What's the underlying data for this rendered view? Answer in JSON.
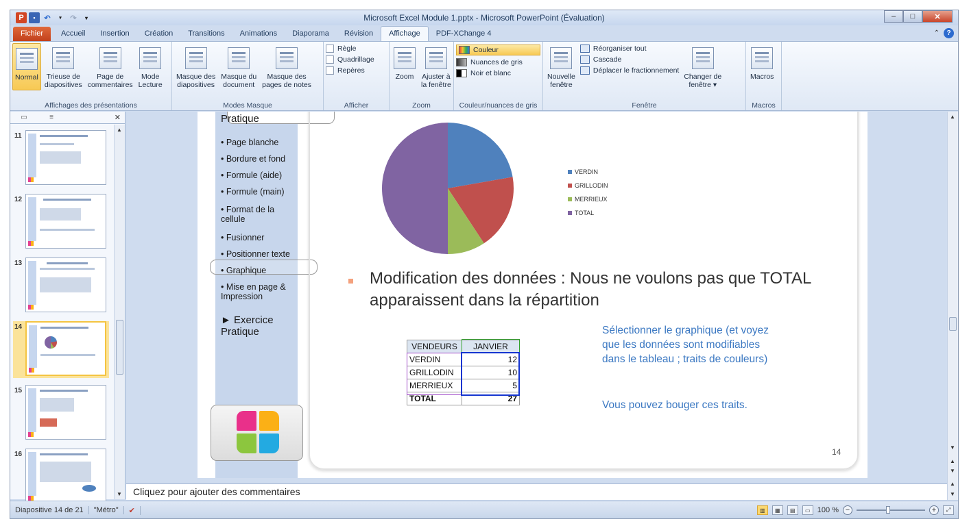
{
  "window": {
    "title": "Microsoft Excel Module 1.pptx - Microsoft PowerPoint (Évaluation)",
    "app_icon": "P"
  },
  "tabs": [
    {
      "label": "Fichier"
    },
    {
      "label": "Accueil"
    },
    {
      "label": "Insertion"
    },
    {
      "label": "Création"
    },
    {
      "label": "Transitions"
    },
    {
      "label": "Animations"
    },
    {
      "label": "Diaporama"
    },
    {
      "label": "Révision"
    },
    {
      "label": "Affichage"
    },
    {
      "label": "PDF-XChange 4"
    }
  ],
  "ribbon": {
    "views": {
      "label": "Affichages des présentations",
      "buttons": [
        "Normal",
        "Trieuse de\ndiapositives",
        "Page de\ncommentaires",
        "Mode\nLecture"
      ]
    },
    "masters": {
      "label": "Modes Masque",
      "buttons": [
        "Masque des\ndiapositives",
        "Masque du\ndocument",
        "Masque des\npages de notes"
      ]
    },
    "show": {
      "label": "Afficher",
      "items": [
        "Règle",
        "Quadrillage",
        "Repères"
      ]
    },
    "zoom": {
      "label": "Zoom",
      "buttons": [
        "Zoom",
        "Ajuster à\nla fenêtre"
      ]
    },
    "color": {
      "label": "Couleur/nuances de gris",
      "items": [
        "Couleur",
        "Nuances de gris",
        "Noir et blanc"
      ]
    },
    "window": {
      "label": "Fenêtre",
      "new_window": "Nouvelle\nfenêtre",
      "items": [
        "Réorganiser tout",
        "Cascade",
        "Déplacer le fractionnement"
      ],
      "switch": "Changer de\nfenêtre ▾"
    },
    "macros": {
      "label": "Macros",
      "button": "Macros"
    }
  },
  "thumbnails": [
    {
      "num": "11"
    },
    {
      "num": "12"
    },
    {
      "num": "13"
    },
    {
      "num": "14"
    },
    {
      "num": "15"
    },
    {
      "num": "16"
    }
  ],
  "slide": {
    "sidebar_title": "Pratique",
    "menu": [
      "• Page blanche",
      "• Bordure et fond",
      "• Formule (aide)",
      "• Formule (main)",
      "• Format de la\ncellule",
      "• Fusionner",
      "• Positionner texte",
      "• Graphique",
      "• Mise en page &\nImpression"
    ],
    "exercise": "► Exercice\nPratique",
    "main_text": "Modification des données : Nous ne voulons pas que TOTAL apparaissent dans la répartition",
    "blue_text": "Sélectionner le graphique (et voyez que les données sont modifiables dans le tableau ; traits  de couleurs)",
    "blue_text2": "Vous pouvez bouger ces traits.",
    "page_number": "14",
    "table": {
      "headers": [
        "VENDEURS",
        "JANVIER"
      ],
      "rows": [
        [
          "VERDIN",
          "12"
        ],
        [
          "GRILLODIN",
          "10"
        ],
        [
          "MERRIEUX",
          "5"
        ],
        [
          "TOTAL",
          "27"
        ]
      ]
    }
  },
  "chart_data": {
    "type": "pie",
    "categories": [
      "VERDIN",
      "GRILLODIN",
      "MERRIEUX",
      "TOTAL"
    ],
    "values": [
      12,
      10,
      5,
      27
    ],
    "colors": [
      "#4f81bd",
      "#c0504d",
      "#9bbb59",
      "#8064a2"
    ],
    "legend_position": "right"
  },
  "notes": {
    "placeholder": "Cliquez pour ajouter des commentaires"
  },
  "status": {
    "slide": "Diapositive 14 de 21",
    "theme": "\"Métro\"",
    "zoom": "100 %"
  }
}
